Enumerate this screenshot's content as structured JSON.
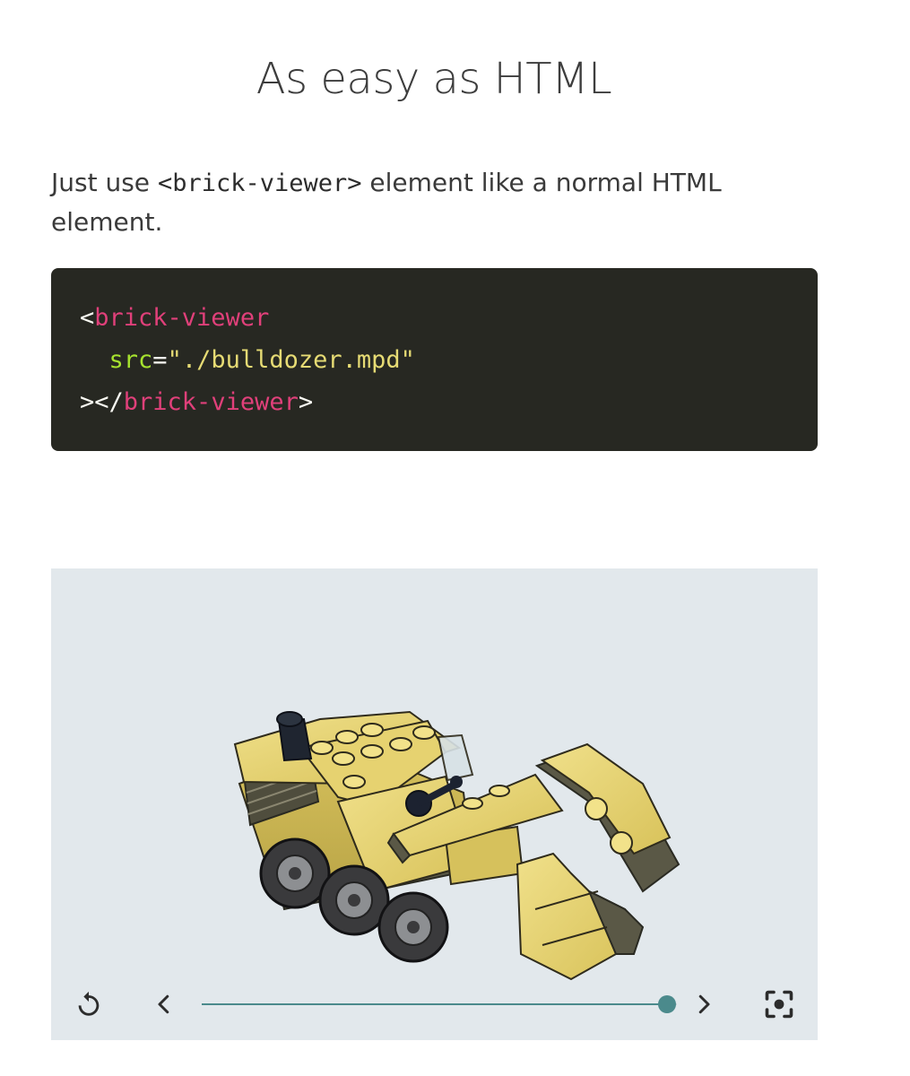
{
  "page": {
    "title": "As easy as HTML",
    "intro_prefix": "Just use ",
    "intro_code": "<brick-viewer>",
    "intro_suffix": " element like a normal HTML element."
  },
  "code_block": {
    "line1_open": "<",
    "line1_tag": "brick-viewer",
    "line2_indent": "  ",
    "line2_attr": "src",
    "line2_eq": "=",
    "line2_value": "\"./bulldozer.mpd\"",
    "line3_close_open": "></",
    "line3_tag": "brick-viewer",
    "line3_close": ">"
  },
  "viewer": {
    "model_name": "bulldozer.mpd",
    "step_progress": 0.98,
    "controls": {
      "restart_icon": "restart-icon",
      "prev_icon": "chevron-left-icon",
      "next_icon": "chevron-right-icon",
      "focus_icon": "center-focus-icon"
    }
  },
  "colors": {
    "code_bg": "#272822",
    "code_tag": "#e0407a",
    "code_attr": "#a6e22e",
    "code_string": "#e6db74",
    "viewer_bg": "#e2e8ec",
    "slider_accent": "#4b8a8c",
    "brick_yellow": "#e8d56a",
    "brick_dark": "#4e4c3c"
  }
}
